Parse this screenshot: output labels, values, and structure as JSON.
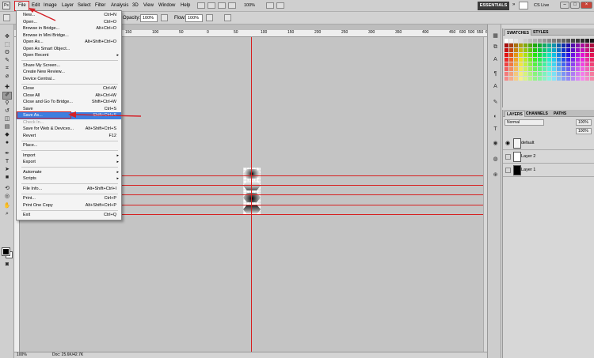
{
  "app": {
    "logo": "Ps"
  },
  "menubar": {
    "items": [
      "File",
      "Edit",
      "Image",
      "Layer",
      "Select",
      "Filter",
      "Analysis",
      "3D",
      "View",
      "Window",
      "Help"
    ],
    "zoom": "100%",
    "workspace": "ESSENTIALS",
    "chevron": "»",
    "cslive": "CS Live",
    "win_min": "–",
    "win_max": "□",
    "win_close": "×"
  },
  "options": {
    "opacity_label": "Opacity:",
    "opacity_value": "100%",
    "flow_label": "Flow:",
    "flow_value": "100%"
  },
  "ruler": {
    "h_ticks": [
      "150",
      "100",
      "50",
      "0",
      "50",
      "100",
      "150",
      "200",
      "250",
      "300",
      "350",
      "400",
      "450",
      "500",
      "550",
      "600",
      "650"
    ]
  },
  "status": {
    "zoom": "100%",
    "doc": "Doc: 25.6K/42.7K"
  },
  "file_menu": {
    "items": [
      {
        "label": "New...",
        "shortcut": "Ctrl+N"
      },
      {
        "label": "Open...",
        "shortcut": "Ctrl+O"
      },
      {
        "label": "Browse in Bridge...",
        "shortcut": "Alt+Ctrl+O"
      },
      {
        "label": "Browse in Mini Bridge...",
        "shortcut": ""
      },
      {
        "label": "Open As...",
        "shortcut": "Alt+Shift+Ctrl+O"
      },
      {
        "label": "Open As Smart Object...",
        "shortcut": ""
      },
      {
        "label": "Open Recent",
        "shortcut": ""
      },
      {
        "label": "Share My Screen...",
        "shortcut": ""
      },
      {
        "label": "Create New Review...",
        "shortcut": ""
      },
      {
        "label": "Device Central...",
        "shortcut": ""
      },
      {
        "label": "Close",
        "shortcut": "Ctrl+W"
      },
      {
        "label": "Close All",
        "shortcut": "Alt+Ctrl+W"
      },
      {
        "label": "Close and Go To Bridge...",
        "shortcut": "Shift+Ctrl+W"
      },
      {
        "label": "Save",
        "shortcut": "Ctrl+S"
      },
      {
        "label": "Save As...",
        "shortcut": "Shift+Ctrl+S"
      },
      {
        "label": "Check In...",
        "shortcut": ""
      },
      {
        "label": "Save for Web & Devices...",
        "shortcut": "Alt+Shift+Ctrl+S"
      },
      {
        "label": "Revert",
        "shortcut": "F12"
      },
      {
        "label": "Place...",
        "shortcut": ""
      },
      {
        "label": "Import",
        "shortcut": ""
      },
      {
        "label": "Export",
        "shortcut": ""
      },
      {
        "label": "Automate",
        "shortcut": ""
      },
      {
        "label": "Scripts",
        "shortcut": ""
      },
      {
        "label": "File Info...",
        "shortcut": "Alt+Shift+Ctrl+I"
      },
      {
        "label": "Print...",
        "shortcut": "Ctrl+P"
      },
      {
        "label": "Print One Copy",
        "shortcut": "Alt+Shift+Ctrl+P"
      },
      {
        "label": "Exit",
        "shortcut": "Ctrl+Q"
      }
    ],
    "submenu_arrow": "▸"
  },
  "swatches_panel": {
    "tabs": [
      "SWATCHES",
      "STYLES"
    ]
  },
  "layers_panel": {
    "tabs": [
      "LAYERS",
      "CHANNELS",
      "PATHS"
    ],
    "blend_mode": "Normal",
    "opacity": "100%",
    "fill": "100%",
    "layers": [
      "default",
      "Layer 2",
      "Layer 1"
    ]
  },
  "colors": {
    "guide": "#d62020",
    "selection": "#3d7ee0",
    "annotation": "#d42027"
  }
}
